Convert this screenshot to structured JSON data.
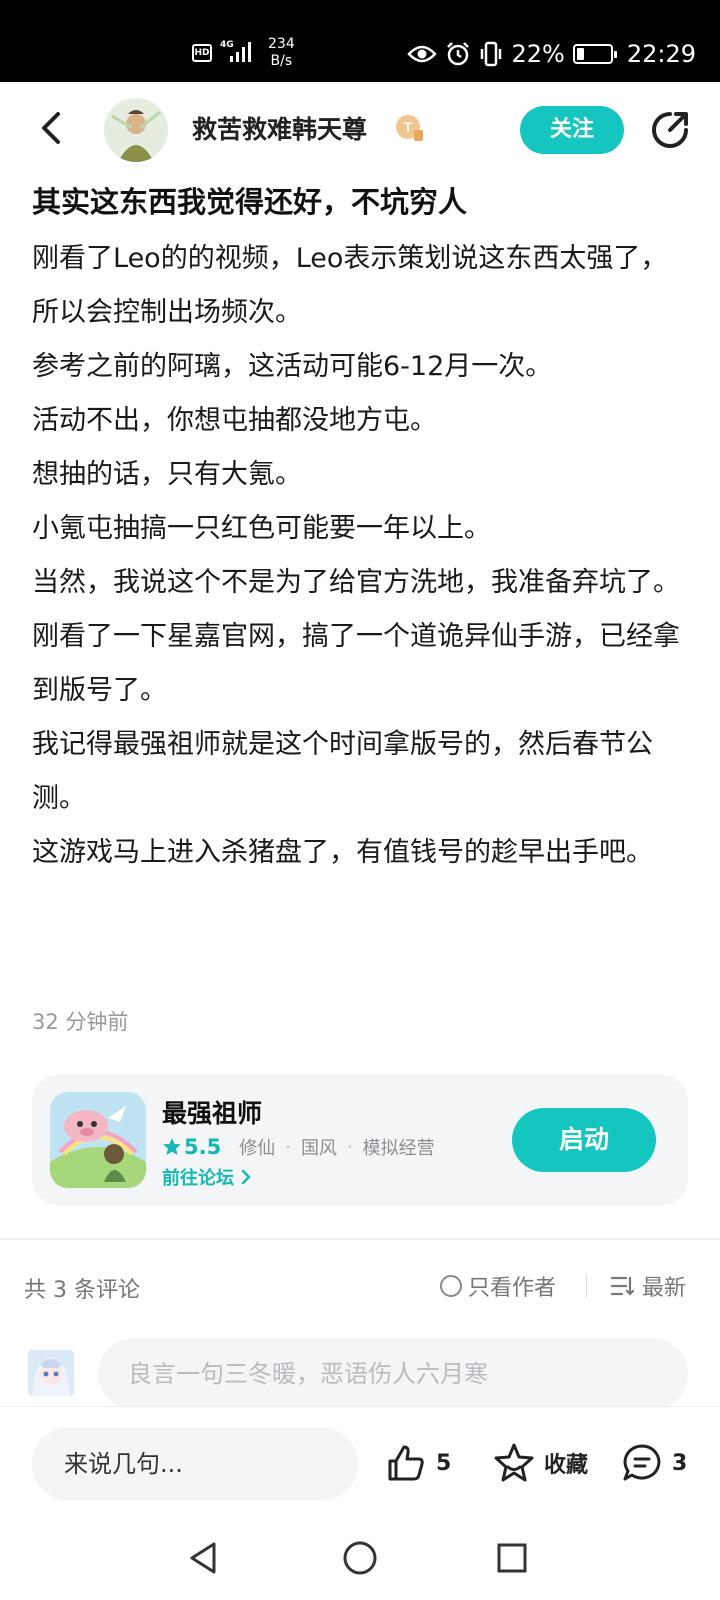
{
  "status_bar": {
    "hd": "HD",
    "network": "4G",
    "speed_value": "234",
    "speed_unit": "B/s",
    "battery": "22%",
    "battery_level": 0.22,
    "time": "22:29"
  },
  "header": {
    "author_name": "救苦救难韩天尊",
    "badge": "T",
    "follow_label": "关注"
  },
  "post": {
    "title": "其实这东西我觉得还好，不坑穷人",
    "paragraphs": [
      "刚看了Leo的的视频，Leo表示策划说这东西太强了，所以会控制出场频次。",
      "参考之前的阿璃，这活动可能6-12月一次。",
      "活动不出，你想屯抽都没地方屯。",
      "想抽的话，只有大氪。",
      "小氪屯抽搞一只红色可能要一年以上。",
      "当然，我说这个不是为了给官方洗地，我准备弃坑了。",
      "刚看了一下星嘉官网，搞了一个道诡异仙手游，已经拿到版号了。",
      "我记得最强祖师就是这个时间拿版号的，然后春节公测。",
      "这游戏马上进入杀猪盘了，有值钱号的趁早出手吧。"
    ],
    "time": "32 分钟前"
  },
  "game_card": {
    "name": "最强祖师",
    "rating": "5.5",
    "tags": [
      "修仙",
      "国风",
      "模拟经营"
    ],
    "forum_link": "前往论坛",
    "launch_label": "启动"
  },
  "comments": {
    "count_label": "共 3 条评论",
    "author_only_label": "只看作者",
    "sort_label": "最新",
    "input_placeholder": "良言一句三冬暖，恶语伤人六月寒"
  },
  "action_bar": {
    "input_placeholder": "来说几句...",
    "like_count": "5",
    "favorite_label": "收藏",
    "comment_count": "3"
  },
  "colors": {
    "accent": "#15c5c0",
    "accent_text": "#15b8b2"
  }
}
